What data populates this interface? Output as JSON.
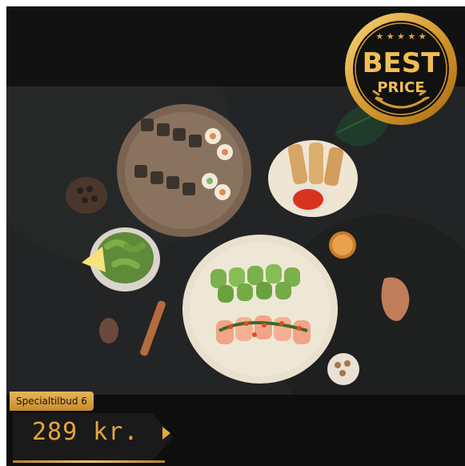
{
  "badge": {
    "line1": "BEST",
    "line2": "PRICE",
    "stars": "★ ★ ★ ★ ★"
  },
  "offer": {
    "label": "Specialtilbud 6",
    "price": "289 kr."
  },
  "photo": {
    "subject": "sushi-platter-photo"
  },
  "colors": {
    "accent_gold": "#e6a63a",
    "background": "#0e0e0e"
  }
}
